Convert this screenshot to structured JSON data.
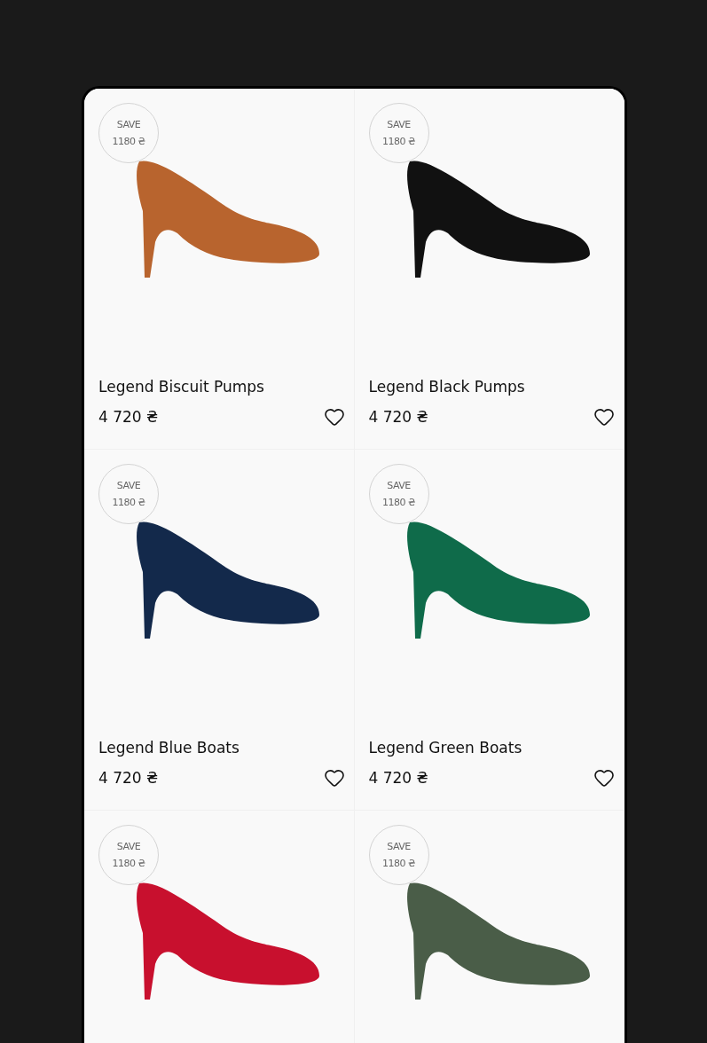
{
  "products": [
    {
      "badge_label": "SAVE",
      "badge_amount": "1180 ₴",
      "color": "#b8642e",
      "name": "Legend Biscuit Pumps",
      "price": "4 720 ₴"
    },
    {
      "badge_label": "SAVE",
      "badge_amount": "1180 ₴",
      "color": "#111111",
      "name": "Legend Black Pumps",
      "price": "4 720 ₴"
    },
    {
      "badge_label": "SAVE",
      "badge_amount": "1180 ₴",
      "color": "#13294b",
      "name": "Legend Blue Boats",
      "price": "4 720 ₴"
    },
    {
      "badge_label": "SAVE",
      "badge_amount": "1180 ₴",
      "color": "#0f6b4a",
      "name": "Legend Green Boats",
      "price": "4 720 ₴"
    },
    {
      "badge_label": "SAVE",
      "badge_amount": "1180 ₴",
      "color": "#c8102e"
    },
    {
      "badge_label": "SAVE",
      "badge_amount": "1180 ₴",
      "color": "#4a5d48"
    }
  ]
}
